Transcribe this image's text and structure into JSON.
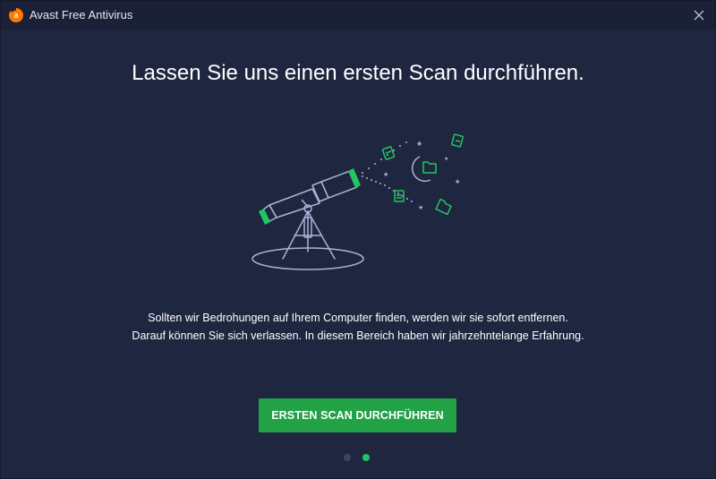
{
  "window": {
    "title": "Avast Free Antivirus",
    "logo_letter": "a",
    "close_icon": "close-icon"
  },
  "main": {
    "headline": "Lassen Sie uns einen ersten Scan durchführen.",
    "body_lines": [
      "Sollten wir Bedrohungen auf Ihrem Computer finden, werden wir sie sofort entfernen.",
      "Darauf können Sie sich verlassen. In diesem Bereich haben wir jahrzehntelange Erfahrung."
    ],
    "cta_label": "ERSTEN SCAN DURCHFÜHREN",
    "illustration": "telescope-night-sky-illustration"
  },
  "pager": {
    "total_pages": 2,
    "current_page": 2
  },
  "colors": {
    "background": "#1f2640",
    "titlebar": "#1a2036",
    "accent_green": "#22a147",
    "active_dot": "#22c563",
    "inactive_dot": "#3a4360",
    "brand_orange": "#ff7800",
    "illustration_stroke": "#a9b4d6"
  }
}
